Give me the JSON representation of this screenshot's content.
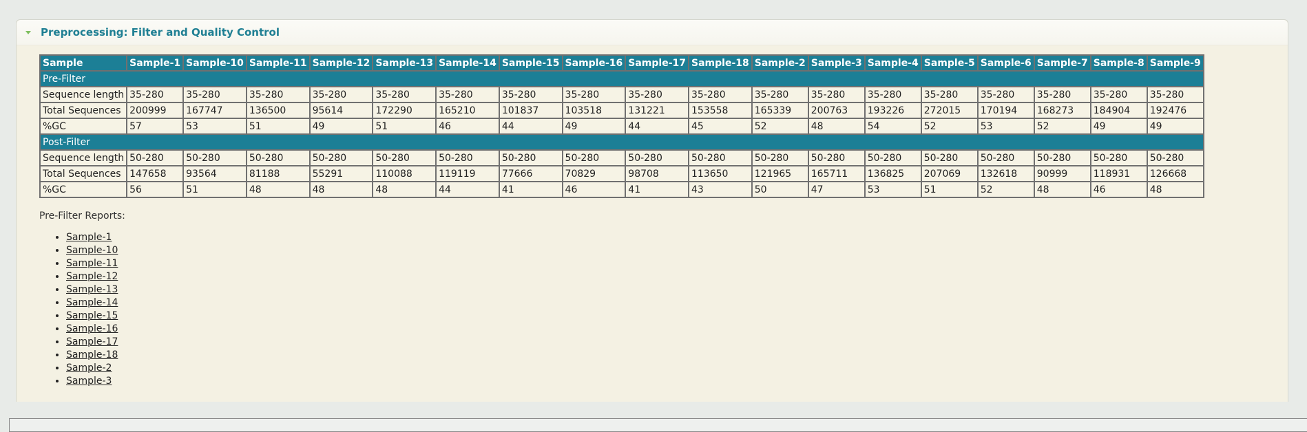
{
  "section": {
    "title": "Preprocessing: Filter and Quality Control"
  },
  "table": {
    "columns": [
      "Sample",
      "Sample-1",
      "Sample-10",
      "Sample-11",
      "Sample-12",
      "Sample-13",
      "Sample-14",
      "Sample-15",
      "Sample-16",
      "Sample-17",
      "Sample-18",
      "Sample-2",
      "Sample-3",
      "Sample-4",
      "Sample-5",
      "Sample-6",
      "Sample-7",
      "Sample-8",
      "Sample-9"
    ],
    "groups": [
      {
        "label": "Pre-Filter",
        "rows": [
          {
            "label": "Sequence length",
            "values": [
              "35-280",
              "35-280",
              "35-280",
              "35-280",
              "35-280",
              "35-280",
              "35-280",
              "35-280",
              "35-280",
              "35-280",
              "35-280",
              "35-280",
              "35-280",
              "35-280",
              "35-280",
              "35-280",
              "35-280",
              "35-280"
            ]
          },
          {
            "label": "Total Sequences",
            "values": [
              "200999",
              "167747",
              "136500",
              "95614",
              "172290",
              "165210",
              "101837",
              "103518",
              "131221",
              "153558",
              "165339",
              "200763",
              "193226",
              "272015",
              "170194",
              "168273",
              "184904",
              "192476"
            ]
          },
          {
            "label": "%GC",
            "values": [
              "57",
              "53",
              "51",
              "49",
              "51",
              "46",
              "44",
              "49",
              "44",
              "45",
              "52",
              "48",
              "54",
              "52",
              "53",
              "52",
              "49",
              "49"
            ]
          }
        ]
      },
      {
        "label": "Post-Filter",
        "rows": [
          {
            "label": "Sequence length",
            "values": [
              "50-280",
              "50-280",
              "50-280",
              "50-280",
              "50-280",
              "50-280",
              "50-280",
              "50-280",
              "50-280",
              "50-280",
              "50-280",
              "50-280",
              "50-280",
              "50-280",
              "50-280",
              "50-280",
              "50-280",
              "50-280"
            ]
          },
          {
            "label": "Total Sequences",
            "values": [
              "147658",
              "93564",
              "81188",
              "55291",
              "110088",
              "119119",
              "77666",
              "70829",
              "98708",
              "113650",
              "121965",
              "165711",
              "136825",
              "207069",
              "132618",
              "90999",
              "118931",
              "126668"
            ]
          },
          {
            "label": "%GC",
            "values": [
              "56",
              "51",
              "48",
              "48",
              "48",
              "44",
              "41",
              "46",
              "41",
              "43",
              "50",
              "47",
              "53",
              "51",
              "52",
              "48",
              "46",
              "48"
            ]
          }
        ]
      }
    ]
  },
  "reports": {
    "label": "Pre-Filter Reports:",
    "items": [
      "Sample-1",
      "Sample-10",
      "Sample-11",
      "Sample-12",
      "Sample-13",
      "Sample-14",
      "Sample-15",
      "Sample-16",
      "Sample-17",
      "Sample-18",
      "Sample-2",
      "Sample-3"
    ]
  }
}
